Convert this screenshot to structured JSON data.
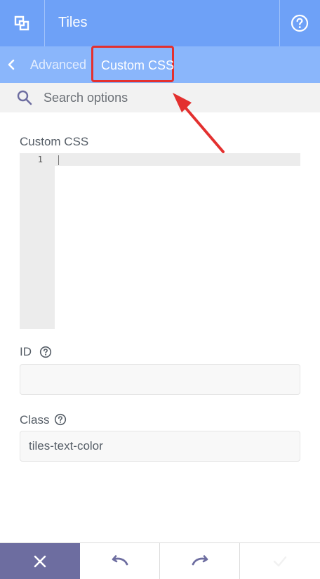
{
  "header": {
    "title": "Tiles",
    "logo_icon": "tiles-logo-icon",
    "help_icon": "help-circle-icon",
    "bg_color": "#6ea1f7"
  },
  "subnav": {
    "back_icon": "chevron-left-icon",
    "breadcrumb": "Advanced",
    "active_tab": "Custom CSS",
    "bg_color": "#8ab6fb"
  },
  "search": {
    "placeholder": "Search options",
    "value": ""
  },
  "fields": {
    "custom_css": {
      "label": "Custom CSS",
      "line_number": "1",
      "content": ""
    },
    "id": {
      "label": "ID",
      "value": ""
    },
    "class": {
      "label": "Class",
      "value": "tiles-text-color"
    }
  },
  "footer": {
    "close_icon": "close-icon",
    "undo_icon": "undo-icon",
    "redo_icon": "redo-icon",
    "save_icon": "check-icon",
    "close_color": "#6d6da0"
  },
  "annotation": {
    "highlight_color": "#e3302f"
  }
}
